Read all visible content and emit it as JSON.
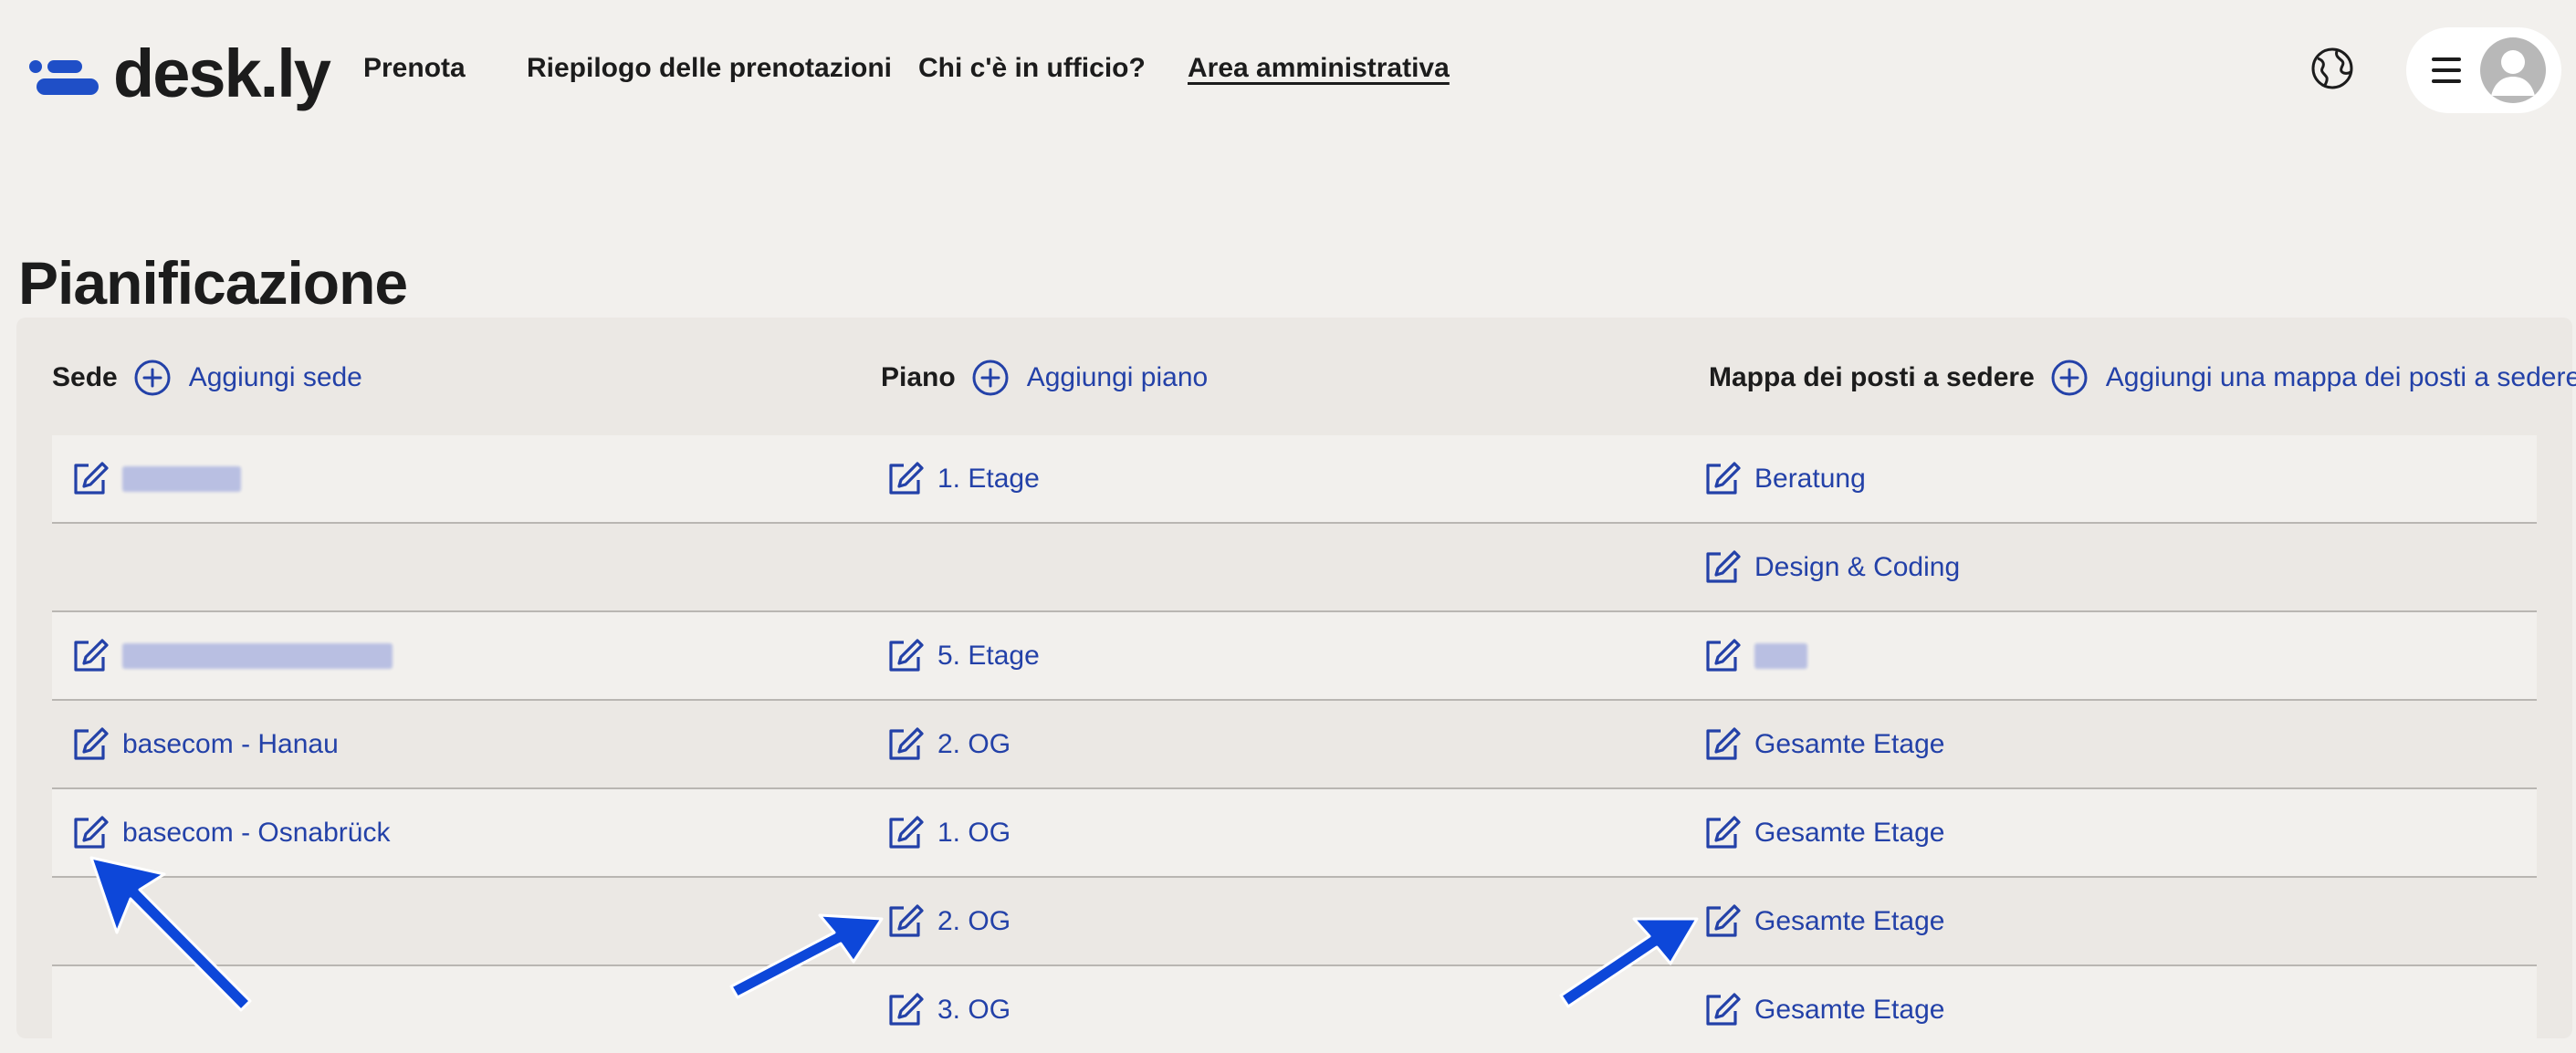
{
  "header": {
    "logo_text": "desk.ly",
    "nav": [
      {
        "label": "Prenota"
      },
      {
        "label": "Riepilogo delle prenotazioni"
      },
      {
        "label": "Chi c'è in ufficio?"
      },
      {
        "label": "Area amministrativa"
      }
    ]
  },
  "page": {
    "title": "Pianificazione"
  },
  "columns": [
    {
      "title": "Sede",
      "add_label": "Aggiungi sede"
    },
    {
      "title": "Piano",
      "add_label": "Aggiungi piano"
    },
    {
      "title": "Mappa dei posti a sedere",
      "add_label": "Aggiungi una mappa dei posti a sedere"
    }
  ],
  "rows": [
    {
      "site": "",
      "floor": "1. Etage",
      "map": "Beratung"
    },
    {
      "site": "",
      "floor": "",
      "map": "Design & Coding"
    },
    {
      "site": "",
      "floor": "5. Etage",
      "map": ""
    },
    {
      "site": "basecom - Hanau",
      "floor": "2. OG",
      "map": "Gesamte Etage"
    },
    {
      "site": "basecom - Osnabrück",
      "floor": "1. OG",
      "map": "Gesamte Etage"
    },
    {
      "site": "",
      "floor": "2. OG",
      "map": "Gesamte Etage"
    },
    {
      "site": "",
      "floor": "3. OG",
      "map": "Gesamte Etage"
    }
  ],
  "icons": {
    "edit": "edit-icon",
    "add": "plus-circle-icon",
    "language": "globe-icon",
    "menu": "hamburger-menu-icon",
    "user": "user-avatar-icon"
  },
  "colors": {
    "accent": "#2341a8",
    "brand": "#1f4fc7",
    "annotation_arrow": "#0d47d9"
  }
}
